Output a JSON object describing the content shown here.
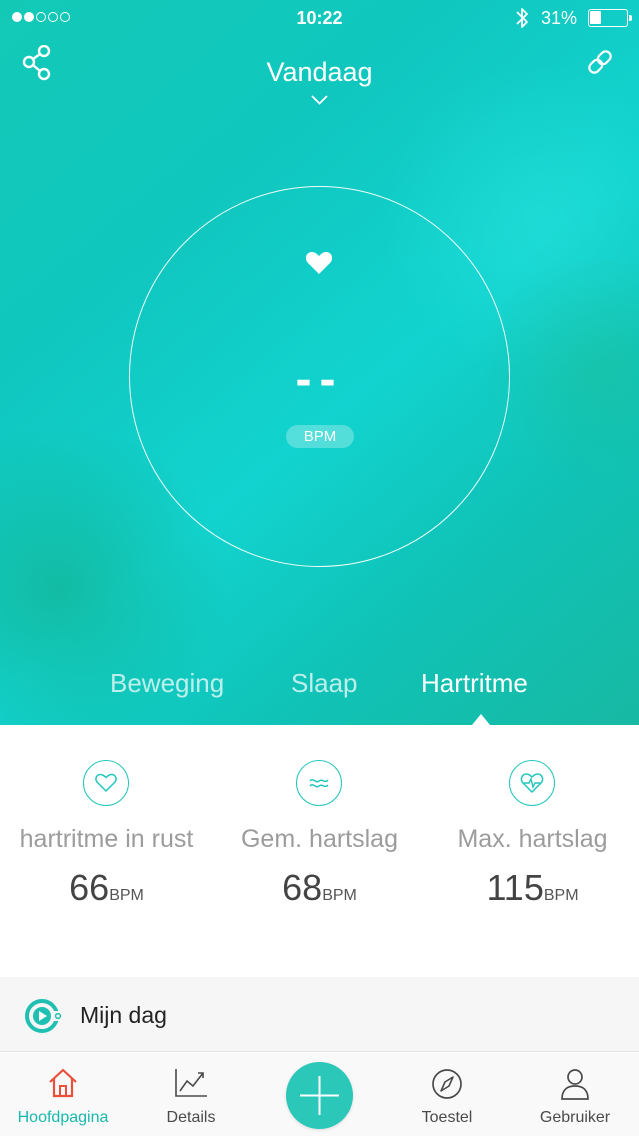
{
  "status_bar": {
    "time": "10:22",
    "battery_percent": "31%",
    "battery_level": 0.31,
    "signal_filled": 2,
    "signal_total": 5
  },
  "header": {
    "title": "Vandaag",
    "share_icon": "share-icon",
    "link_icon": "link-icon",
    "chevron_icon": "chevron-down-icon"
  },
  "measurement": {
    "icon": "heart-icon",
    "value": "--",
    "unit": "BPM"
  },
  "tabs": [
    {
      "label": "Beweging",
      "active": false
    },
    {
      "label": "Slaap",
      "active": false
    },
    {
      "label": "Hartritme",
      "active": true
    }
  ],
  "stats": [
    {
      "icon": "heart-outline-icon",
      "label": "hartritme in rust",
      "value": "66",
      "unit": "BPM"
    },
    {
      "icon": "wave-icon",
      "label": "Gem. hartslag",
      "value": "68",
      "unit": "BPM"
    },
    {
      "icon": "heart-pulse-icon",
      "label": "Max. hartslag",
      "value": "115",
      "unit": "BPM"
    }
  ],
  "my_day": {
    "label": "Mijn dag"
  },
  "tabbar": {
    "home": "Hoofdpagina",
    "details": "Details",
    "device": "Toestel",
    "user": "Gebruiker"
  },
  "colors": {
    "accent": "#19b9ad",
    "home_icon": "#e8503c",
    "gradient_start": "#13c9b6",
    "gradient_end": "#17b9a3"
  }
}
